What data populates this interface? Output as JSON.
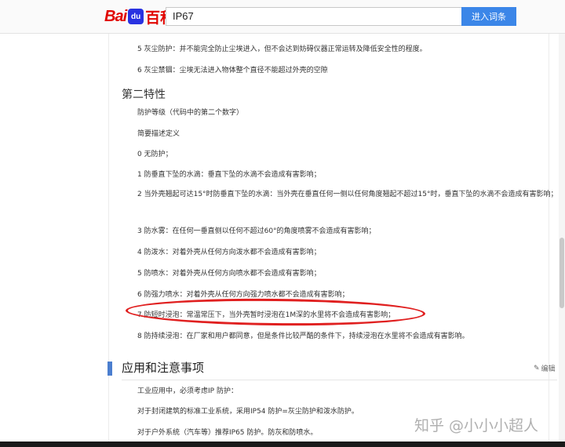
{
  "header": {
    "logo_bai": "Bai",
    "logo_du": "du",
    "logo_baike": "百科",
    "search_value": "IP67",
    "search_button": "进入词条"
  },
  "content": {
    "dust5": "5 灰尘防护：并不能完全防止尘埃进入，但不会达到妨碍仪器正常运转及降低安全性的程度。",
    "dust6": "6 灰尘禁锢：尘埃无法进入物体整个直径不能超过外壳的空隙",
    "second_heading": "第二特性",
    "protect_grade": "防护等级（代码中的第二个数字）",
    "brief_def": "简要描述定义",
    "w0": "0 无防护；",
    "w1": "1 防垂直下坠的水滴：垂直下坠的水滴不会造成有害影响；",
    "w2": "2 当外壳翘起可达15°时防垂直下坠的水滴：当外壳在垂直任何一侧以任何角度翘起不超过15°时，垂直下坠的水滴不会造成有害影响；",
    "w3": "3 防水雾：在任何一垂直侧以任何不超过60°的角度喷雾不会造成有害影响；",
    "w4": "4 防泼水：对着外壳从任何方向泼水都不会造成有害影响；",
    "w5": "5 防喷水：对着外壳从任何方向喷水都不会造成有害影响；",
    "w6": "6 防强力喷水：对着外壳从任何方向强力喷水都不会造成有害影响；",
    "w7": "7 防短时浸泡：常温常压下，当外壳暂时浸泡在1M深的水里将不会造成有害影响；",
    "w8": "8 防持续浸泡：在厂家和用户都同意，但是条件比较严酷的条件下，持续浸泡在水里将不会造成有害影响。",
    "section_heading": "应用和注意事项",
    "edit_label": "编辑",
    "app1": "工业应用中，必须考虑IP 防护：",
    "app2": "对于封闭建筑的标准工业系统，采用IP54 防护=灰尘防护和泼水防护。",
    "app3": "对于户外系统（汽车等）推荐IP65 防护。防灰和防喷水。"
  },
  "watermark": "知乎 @小小小超人",
  "colors": {
    "brand_red": "#e10601",
    "brand_blue": "#2932e1",
    "button_blue": "#3b86e8",
    "annotation_red": "#e02020",
    "section_accent": "#4b7ecf"
  }
}
